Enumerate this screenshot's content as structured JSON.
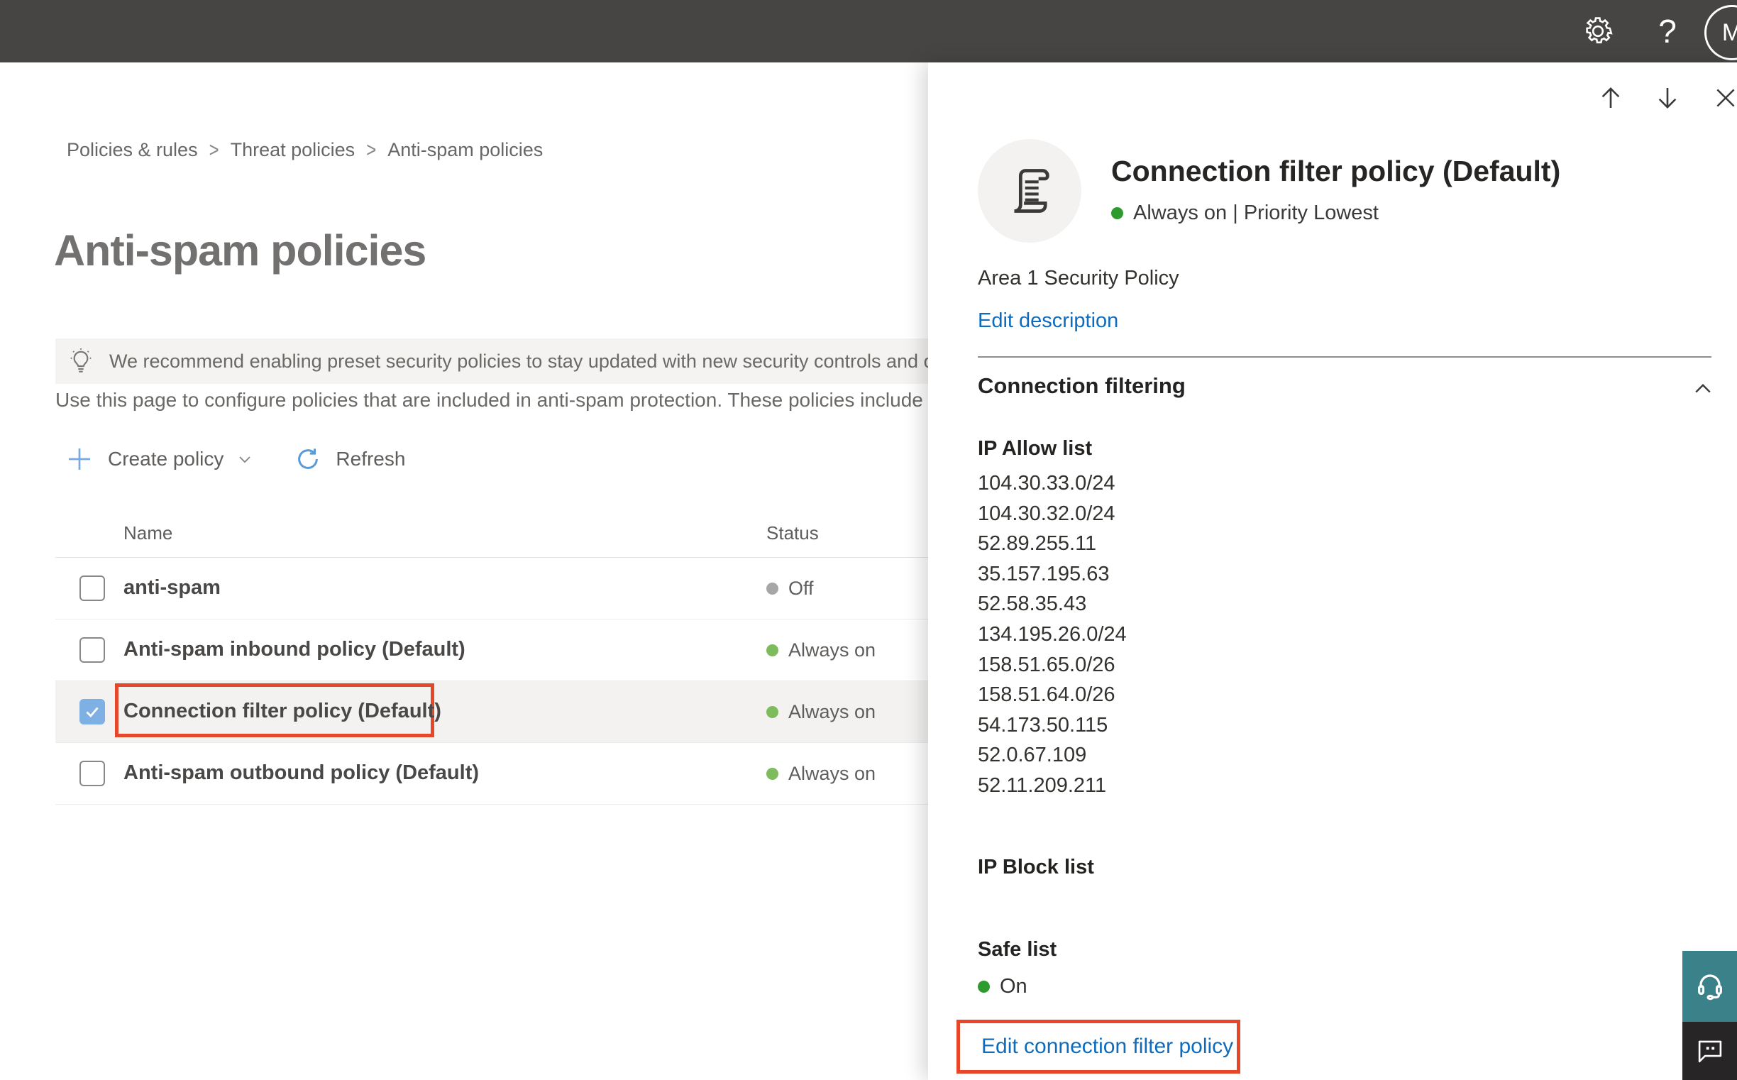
{
  "topbar": {
    "avatar_initial": "M"
  },
  "breadcrumb": {
    "items": [
      "Policies & rules",
      "Threat policies",
      "Anti-spam policies"
    ]
  },
  "page": {
    "title": "Anti-spam policies",
    "banner_text": "We recommend enabling preset security policies to stay updated with new security controls and our recomme",
    "description": "Use this page to configure policies that are included in anti-spam protection. These policies include"
  },
  "toolbar": {
    "create_label": "Create policy",
    "refresh_label": "Refresh"
  },
  "table": {
    "columns": [
      "Name",
      "Status"
    ],
    "rows": [
      {
        "name": "anti-spam",
        "status": "Off",
        "dot": "gray",
        "checked": false,
        "selected": false
      },
      {
        "name": "Anti-spam inbound policy (Default)",
        "status": "Always on",
        "dot": "green",
        "checked": false,
        "selected": false
      },
      {
        "name": "Connection filter policy (Default)",
        "status": "Always on",
        "dot": "green",
        "checked": true,
        "selected": true,
        "annotated": true
      },
      {
        "name": "Anti-spam outbound policy (Default)",
        "status": "Always on",
        "dot": "green",
        "checked": false,
        "selected": false
      }
    ]
  },
  "panel": {
    "title": "Connection filter policy (Default)",
    "status_text": "Always on | Priority Lowest",
    "description": "Area 1 Security Policy",
    "edit_description": "Edit description",
    "section": "Connection filtering",
    "ip_allow_label": "IP Allow list",
    "ip_allow": [
      "104.30.33.0/24",
      "104.30.32.0/24",
      "52.89.255.11",
      "35.157.195.63",
      "52.58.35.43",
      "134.195.26.0/24",
      "158.51.65.0/26",
      "158.51.64.0/26",
      "54.173.50.115",
      "52.0.67.109",
      "52.11.209.211"
    ],
    "ip_block_label": "IP Block list",
    "safe_list_label": "Safe list",
    "safe_list_status": "On",
    "edit_link": "Edit connection filter policy"
  },
  "icons": {
    "gear-icon": "settings gear",
    "help-icon": "?",
    "lightbulb-icon": "tip bulb",
    "plus-icon": "+",
    "chevron-down-icon": "v",
    "refresh-icon": "circular arrow",
    "arrow-up-icon": "up",
    "arrow-down-icon": "down",
    "close-icon": "x",
    "scroll-icon": "policy scroll",
    "chevron-up-icon": "^",
    "headset-icon": "support headset",
    "feedback-icon": "chat bubble"
  },
  "colors": {
    "topbar_bg": "#474543",
    "link_blue": "#0f6cbd",
    "toolbar_blue": "#76a9dd",
    "annotation_red": "#e5472a",
    "checkbox_blue": "#7fb0e3",
    "status_green_table": "#7dbb5c",
    "status_green_panel": "#2d9b2d",
    "status_gray": "#a8a6a4",
    "selected_row_bg": "#f3f2f1",
    "support_teal": "#3a8189",
    "feedback_dark": "#272525"
  }
}
